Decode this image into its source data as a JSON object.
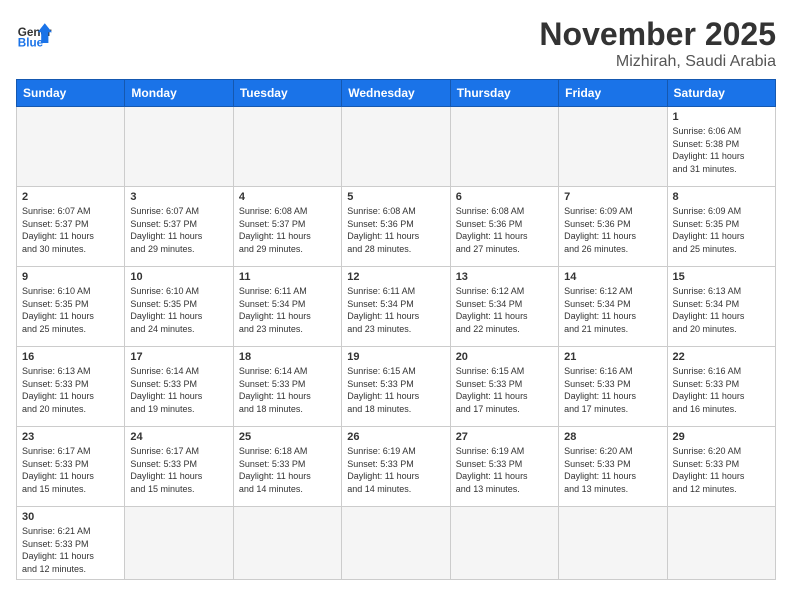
{
  "header": {
    "logo_general": "General",
    "logo_blue": "Blue",
    "month": "November 2025",
    "location": "Mizhirah, Saudi Arabia"
  },
  "weekdays": [
    "Sunday",
    "Monday",
    "Tuesday",
    "Wednesday",
    "Thursday",
    "Friday",
    "Saturday"
  ],
  "days": [
    {
      "num": "",
      "info": ""
    },
    {
      "num": "",
      "info": ""
    },
    {
      "num": "",
      "info": ""
    },
    {
      "num": "",
      "info": ""
    },
    {
      "num": "",
      "info": ""
    },
    {
      "num": "",
      "info": ""
    },
    {
      "num": "1",
      "info": "Sunrise: 6:06 AM\nSunset: 5:38 PM\nDaylight: 11 hours\nand 31 minutes."
    },
    {
      "num": "2",
      "info": "Sunrise: 6:07 AM\nSunset: 5:37 PM\nDaylight: 11 hours\nand 30 minutes."
    },
    {
      "num": "3",
      "info": "Sunrise: 6:07 AM\nSunset: 5:37 PM\nDaylight: 11 hours\nand 29 minutes."
    },
    {
      "num": "4",
      "info": "Sunrise: 6:08 AM\nSunset: 5:37 PM\nDaylight: 11 hours\nand 29 minutes."
    },
    {
      "num": "5",
      "info": "Sunrise: 6:08 AM\nSunset: 5:36 PM\nDaylight: 11 hours\nand 28 minutes."
    },
    {
      "num": "6",
      "info": "Sunrise: 6:08 AM\nSunset: 5:36 PM\nDaylight: 11 hours\nand 27 minutes."
    },
    {
      "num": "7",
      "info": "Sunrise: 6:09 AM\nSunset: 5:36 PM\nDaylight: 11 hours\nand 26 minutes."
    },
    {
      "num": "8",
      "info": "Sunrise: 6:09 AM\nSunset: 5:35 PM\nDaylight: 11 hours\nand 25 minutes."
    },
    {
      "num": "9",
      "info": "Sunrise: 6:10 AM\nSunset: 5:35 PM\nDaylight: 11 hours\nand 25 minutes."
    },
    {
      "num": "10",
      "info": "Sunrise: 6:10 AM\nSunset: 5:35 PM\nDaylight: 11 hours\nand 24 minutes."
    },
    {
      "num": "11",
      "info": "Sunrise: 6:11 AM\nSunset: 5:34 PM\nDaylight: 11 hours\nand 23 minutes."
    },
    {
      "num": "12",
      "info": "Sunrise: 6:11 AM\nSunset: 5:34 PM\nDaylight: 11 hours\nand 23 minutes."
    },
    {
      "num": "13",
      "info": "Sunrise: 6:12 AM\nSunset: 5:34 PM\nDaylight: 11 hours\nand 22 minutes."
    },
    {
      "num": "14",
      "info": "Sunrise: 6:12 AM\nSunset: 5:34 PM\nDaylight: 11 hours\nand 21 minutes."
    },
    {
      "num": "15",
      "info": "Sunrise: 6:13 AM\nSunset: 5:34 PM\nDaylight: 11 hours\nand 20 minutes."
    },
    {
      "num": "16",
      "info": "Sunrise: 6:13 AM\nSunset: 5:33 PM\nDaylight: 11 hours\nand 20 minutes."
    },
    {
      "num": "17",
      "info": "Sunrise: 6:14 AM\nSunset: 5:33 PM\nDaylight: 11 hours\nand 19 minutes."
    },
    {
      "num": "18",
      "info": "Sunrise: 6:14 AM\nSunset: 5:33 PM\nDaylight: 11 hours\nand 18 minutes."
    },
    {
      "num": "19",
      "info": "Sunrise: 6:15 AM\nSunset: 5:33 PM\nDaylight: 11 hours\nand 18 minutes."
    },
    {
      "num": "20",
      "info": "Sunrise: 6:15 AM\nSunset: 5:33 PM\nDaylight: 11 hours\nand 17 minutes."
    },
    {
      "num": "21",
      "info": "Sunrise: 6:16 AM\nSunset: 5:33 PM\nDaylight: 11 hours\nand 17 minutes."
    },
    {
      "num": "22",
      "info": "Sunrise: 6:16 AM\nSunset: 5:33 PM\nDaylight: 11 hours\nand 16 minutes."
    },
    {
      "num": "23",
      "info": "Sunrise: 6:17 AM\nSunset: 5:33 PM\nDaylight: 11 hours\nand 15 minutes."
    },
    {
      "num": "24",
      "info": "Sunrise: 6:17 AM\nSunset: 5:33 PM\nDaylight: 11 hours\nand 15 minutes."
    },
    {
      "num": "25",
      "info": "Sunrise: 6:18 AM\nSunset: 5:33 PM\nDaylight: 11 hours\nand 14 minutes."
    },
    {
      "num": "26",
      "info": "Sunrise: 6:19 AM\nSunset: 5:33 PM\nDaylight: 11 hours\nand 14 minutes."
    },
    {
      "num": "27",
      "info": "Sunrise: 6:19 AM\nSunset: 5:33 PM\nDaylight: 11 hours\nand 13 minutes."
    },
    {
      "num": "28",
      "info": "Sunrise: 6:20 AM\nSunset: 5:33 PM\nDaylight: 11 hours\nand 13 minutes."
    },
    {
      "num": "29",
      "info": "Sunrise: 6:20 AM\nSunset: 5:33 PM\nDaylight: 11 hours\nand 12 minutes."
    },
    {
      "num": "30",
      "info": "Sunrise: 6:21 AM\nSunset: 5:33 PM\nDaylight: 11 hours\nand 12 minutes."
    },
    {
      "num": "",
      "info": ""
    },
    {
      "num": "",
      "info": ""
    },
    {
      "num": "",
      "info": ""
    },
    {
      "num": "",
      "info": ""
    },
    {
      "num": "",
      "info": ""
    },
    {
      "num": "",
      "info": ""
    }
  ]
}
